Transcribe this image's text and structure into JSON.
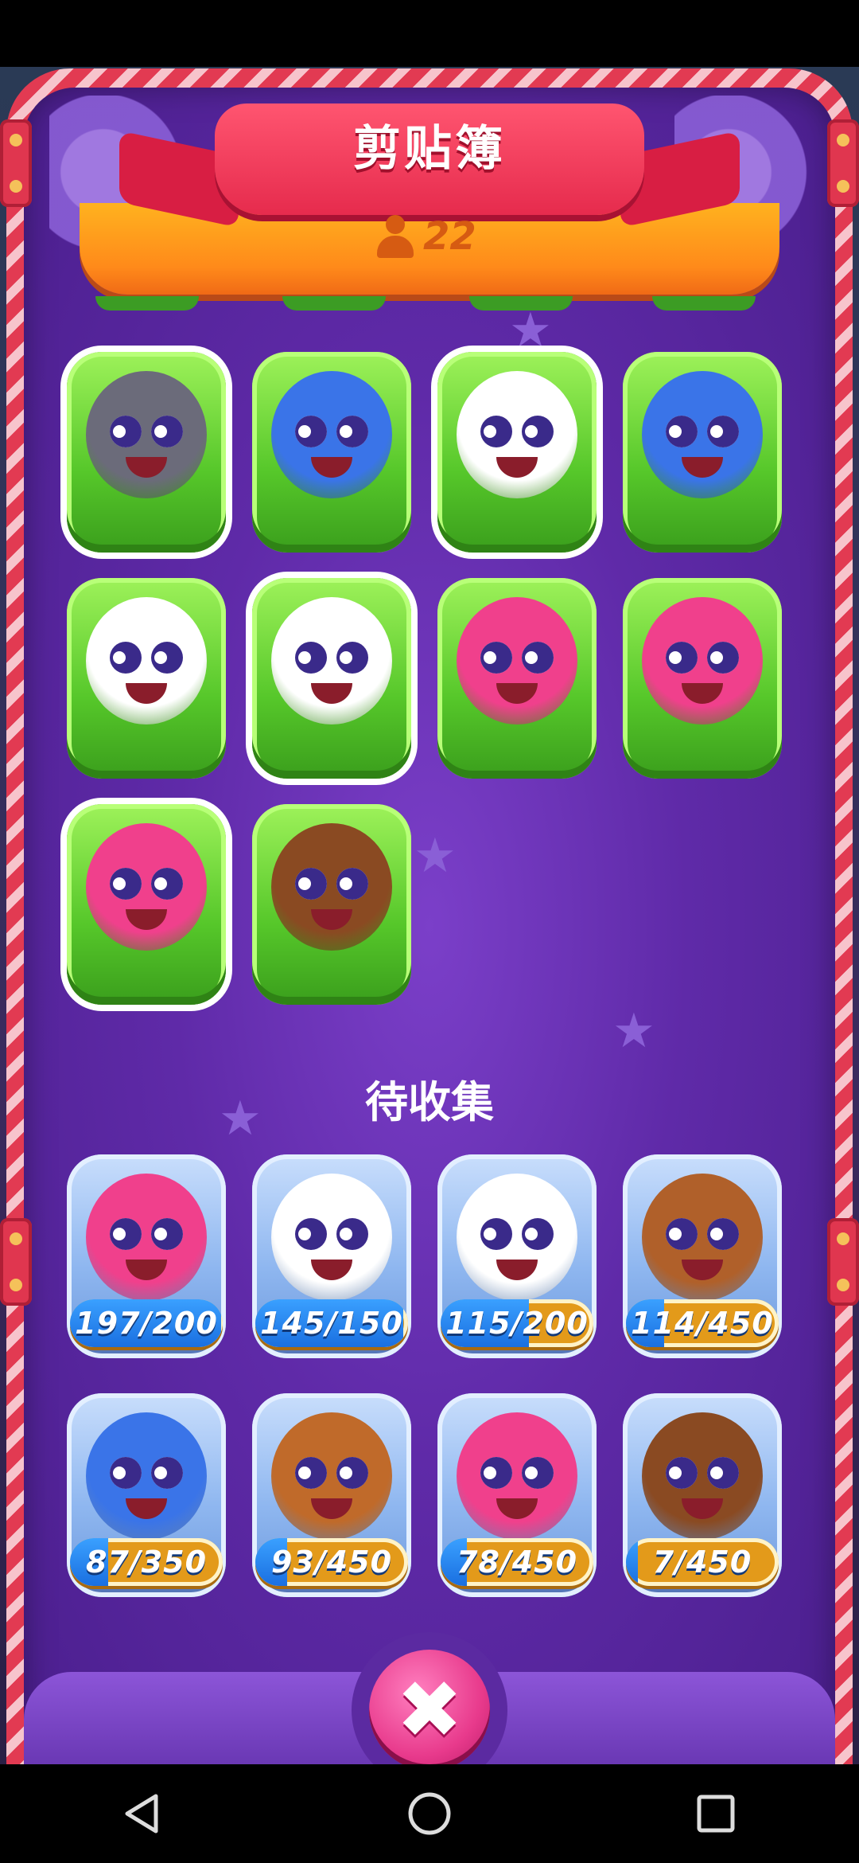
{
  "header": {
    "title": "剪贴簿",
    "player_count": "22",
    "person_icon": "person-icon"
  },
  "collected": {
    "characters": [
      {
        "name": "top-hat-gentleman-pig",
        "tile": "green-white",
        "color": "#6b6b7a"
      },
      {
        "name": "blue-owl-purple-ears",
        "tile": "green",
        "color": "#3a74e8"
      },
      {
        "name": "jester-owl",
        "tile": "green-white",
        "color": "#ffffff"
      },
      {
        "name": "explorer-owl",
        "tile": "green",
        "color": "#3a74e8"
      },
      {
        "name": "orange-hair-llama",
        "tile": "green",
        "color": "#ffffff"
      },
      {
        "name": "unicorn-llama",
        "tile": "green-white",
        "color": "#ffffff"
      },
      {
        "name": "pink-bunny-bowtie",
        "tile": "green",
        "color": "#f0408c"
      },
      {
        "name": "pink-bunny-overalls",
        "tile": "green",
        "color": "#f0408c"
      },
      {
        "name": "pink-bunny-clown-hat",
        "tile": "green-white",
        "color": "#f0408c"
      },
      {
        "name": "brown-dog-flying-hat",
        "tile": "green",
        "color": "#8a4a22"
      }
    ]
  },
  "to_collect": {
    "label": "待收集",
    "characters": [
      {
        "name": "fox-bunny",
        "progress": "197/200",
        "current": 197,
        "total": 200,
        "color": "#f0408c"
      },
      {
        "name": "pirate-llama",
        "progress": "145/150",
        "current": 145,
        "total": 150,
        "color": "#ffffff"
      },
      {
        "name": "sunhat-llama",
        "progress": "115/200",
        "current": 115,
        "total": 200,
        "color": "#ffffff"
      },
      {
        "name": "reindeer-dog",
        "progress": "114/450",
        "current": 114,
        "total": 450,
        "color": "#b0602a"
      },
      {
        "name": "wizard-owl",
        "progress": "87/350",
        "current": 87,
        "total": 350,
        "color": "#3a74e8"
      },
      {
        "name": "furry-monster",
        "progress": "93/450",
        "current": 93,
        "total": 450,
        "color": "#c06a2a"
      },
      {
        "name": "musketeer-bunny",
        "progress": "78/450",
        "current": 78,
        "total": 450,
        "color": "#f0408c"
      },
      {
        "name": "elf-dog",
        "progress": "7/450",
        "current": 7,
        "total": 450,
        "color": "#8a4a22"
      }
    ]
  },
  "close_button": {
    "icon": "close-icon"
  },
  "nav": {
    "back_icon": "back-icon",
    "home_icon": "home-icon",
    "recents_icon": "recents-icon"
  }
}
